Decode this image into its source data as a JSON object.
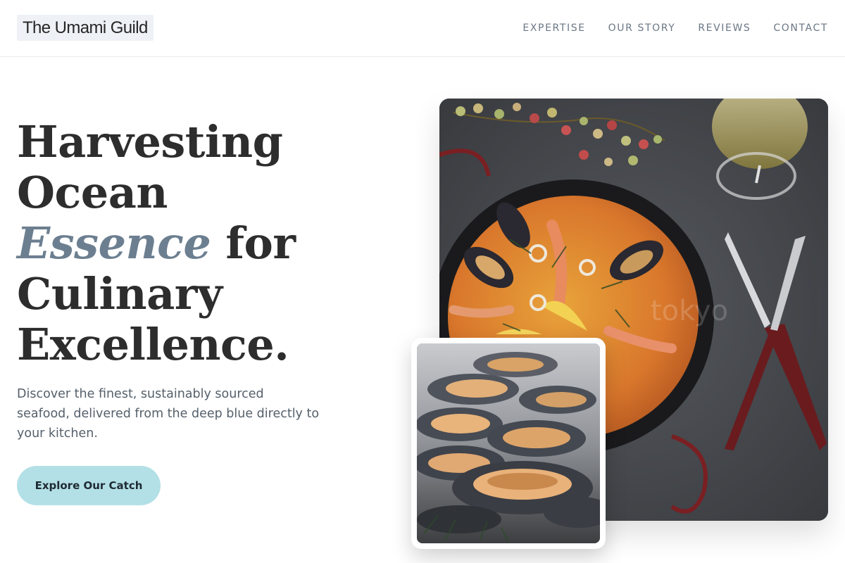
{
  "header": {
    "logo": "The Umami Guild",
    "nav": [
      {
        "label": "EXPERTISE"
      },
      {
        "label": "OUR STORY"
      },
      {
        "label": "REVIEWS"
      },
      {
        "label": "CONTACT"
      }
    ]
  },
  "hero": {
    "headline": {
      "line1": "Harvesting",
      "line2": "Ocean",
      "accent": "Essence",
      "line3_rest": " for",
      "line4": "Culinary",
      "line5": "Excellence."
    },
    "subtext": "Discover the finest, sustainably sourced seafood, delivered from the deep blue directly to your kitchen.",
    "cta_label": "Explore Our Catch"
  },
  "images": {
    "main": "paella-with-seafood-photo",
    "inset": "mussels-closeup-photo"
  },
  "colors": {
    "accent": "#6c7f90",
    "cta": "#b3e0e6",
    "logo_bg": "#eef1f5"
  }
}
